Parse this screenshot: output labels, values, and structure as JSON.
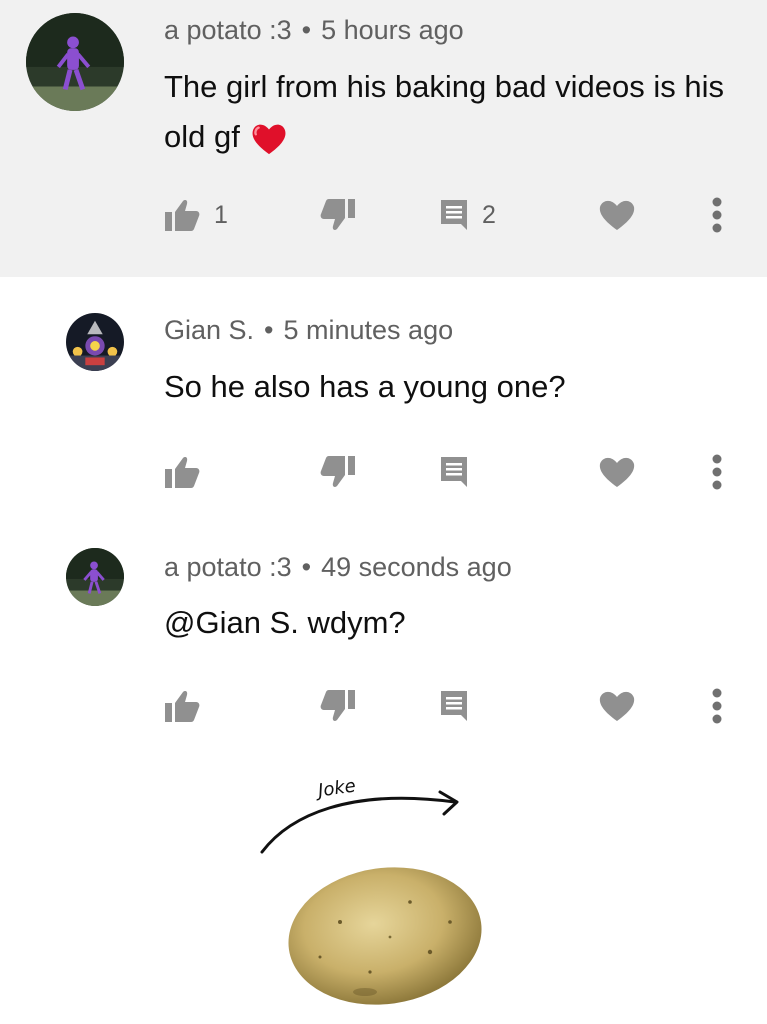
{
  "comments": [
    {
      "author": "a potato :3",
      "separator": "•",
      "time": "5 hours ago",
      "text": "The girl from his baking bad videos is his old gf",
      "like_count": "1",
      "reply_count": "2",
      "highlighted": true
    },
    {
      "author": "Gian S.",
      "separator": "•",
      "time": "5 minutes ago",
      "text": "So he also has a young one?",
      "like_count": "",
      "reply_count": "",
      "highlighted": false
    },
    {
      "author": "a potato :3",
      "separator": "•",
      "time": "49 seconds ago",
      "text": "@Gian S. wdym?",
      "like_count": "",
      "reply_count": "",
      "highlighted": false
    }
  ],
  "annotation": {
    "label": "Joke"
  },
  "icons": {
    "like": "thumbs-up-icon",
    "dislike": "thumbs-down-icon",
    "reply": "reply-comment-icon",
    "heart": "heart-icon",
    "more": "more-vertical-icon",
    "emoji": "red-heart-emoji"
  },
  "colors": {
    "highlight_bg": "#f1f1f1",
    "icon_gray": "#909090",
    "meta_text": "#606060",
    "body_text": "#0f0f0f",
    "emoji_red": "#e0102a"
  }
}
